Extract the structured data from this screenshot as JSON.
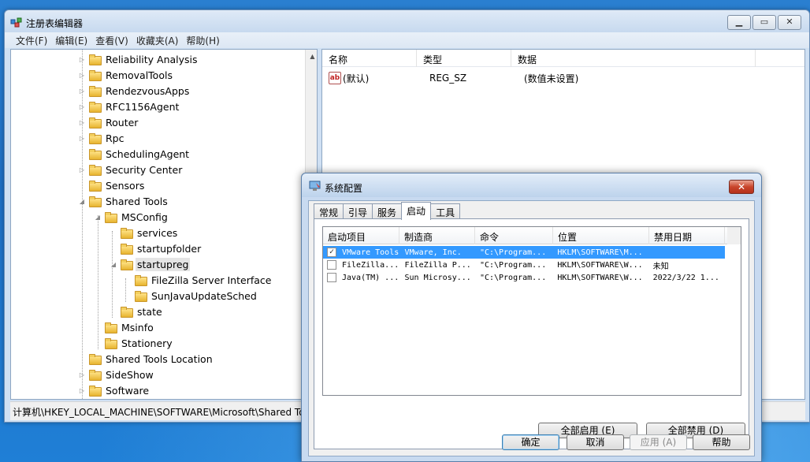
{
  "regedit": {
    "title": "注册表编辑器",
    "menu": [
      "文件(F)",
      "编辑(E)",
      "查看(V)",
      "收藏夹(A)",
      "帮助(H)"
    ],
    "tree": [
      {
        "label": "Reliability Analysis",
        "level": 0,
        "exp": "▷"
      },
      {
        "label": "RemovalTools",
        "level": 0,
        "exp": "▷"
      },
      {
        "label": "RendezvousApps",
        "level": 0,
        "exp": "▷"
      },
      {
        "label": "RFC1156Agent",
        "level": 0,
        "exp": "▷"
      },
      {
        "label": "Router",
        "level": 0,
        "exp": "▷"
      },
      {
        "label": "Rpc",
        "level": 0,
        "exp": "▷"
      },
      {
        "label": "SchedulingAgent",
        "level": 0,
        "exp": ""
      },
      {
        "label": "Security Center",
        "level": 0,
        "exp": "▷"
      },
      {
        "label": "Sensors",
        "level": 0,
        "exp": ""
      },
      {
        "label": "Shared Tools",
        "level": 0,
        "exp": "◢"
      },
      {
        "label": "MSConfig",
        "level": 1,
        "exp": "◢"
      },
      {
        "label": "services",
        "level": 2,
        "exp": ""
      },
      {
        "label": "startupfolder",
        "level": 2,
        "exp": ""
      },
      {
        "label": "startupreg",
        "level": 2,
        "exp": "◢",
        "selected": true
      },
      {
        "label": "FileZilla Server Interface",
        "level": 3,
        "exp": ""
      },
      {
        "label": "SunJavaUpdateSched",
        "level": 3,
        "exp": ""
      },
      {
        "label": "state",
        "level": 2,
        "exp": ""
      },
      {
        "label": "Msinfo",
        "level": 1,
        "exp": ""
      },
      {
        "label": "Stationery",
        "level": 1,
        "exp": ""
      },
      {
        "label": "Shared Tools Location",
        "level": 0,
        "exp": ""
      },
      {
        "label": "SideShow",
        "level": 0,
        "exp": "▷"
      },
      {
        "label": "Software",
        "level": 0,
        "exp": "▷"
      }
    ],
    "columns": [
      "名称",
      "类型",
      "数据"
    ],
    "values": [
      {
        "name": "(默认)",
        "type": "REG_SZ",
        "data": "(数值未设置)"
      }
    ],
    "status": "计算机\\HKEY_LOCAL_MACHINE\\SOFTWARE\\Microsoft\\Shared Tools\\MSConfig\\startupreg"
  },
  "msconfig": {
    "title": "系统配置",
    "close": "✕",
    "tabs": [
      "常规",
      "引导",
      "服务",
      "启动",
      "工具"
    ],
    "active_tab": "启动",
    "columns": [
      "启动项目",
      "制造商",
      "命令",
      "位置",
      "禁用日期"
    ],
    "rows": [
      {
        "checked": true,
        "item": "VMware Tools",
        "maker": "VMware, Inc.",
        "cmd": "\"C:\\Program...",
        "loc": "HKLM\\SOFTWARE\\M...",
        "date": ""
      },
      {
        "checked": false,
        "item": "FileZilla...",
        "maker": "FileZilla P...",
        "cmd": "\"C:\\Program...",
        "loc": "HKLM\\SOFTWARE\\W...",
        "date": "未知"
      },
      {
        "checked": false,
        "item": "Java(TM) ...",
        "maker": "Sun Microsy...",
        "cmd": "\"C:\\Program...",
        "loc": "HKLM\\SOFTWARE\\W...",
        "date": "2022/3/22 1..."
      }
    ],
    "enable_all": "全部启用 (E)",
    "disable_all": "全部禁用 (D)",
    "ok": "确定",
    "cancel": "取消",
    "apply": "应用 (A)",
    "help": "帮助"
  }
}
